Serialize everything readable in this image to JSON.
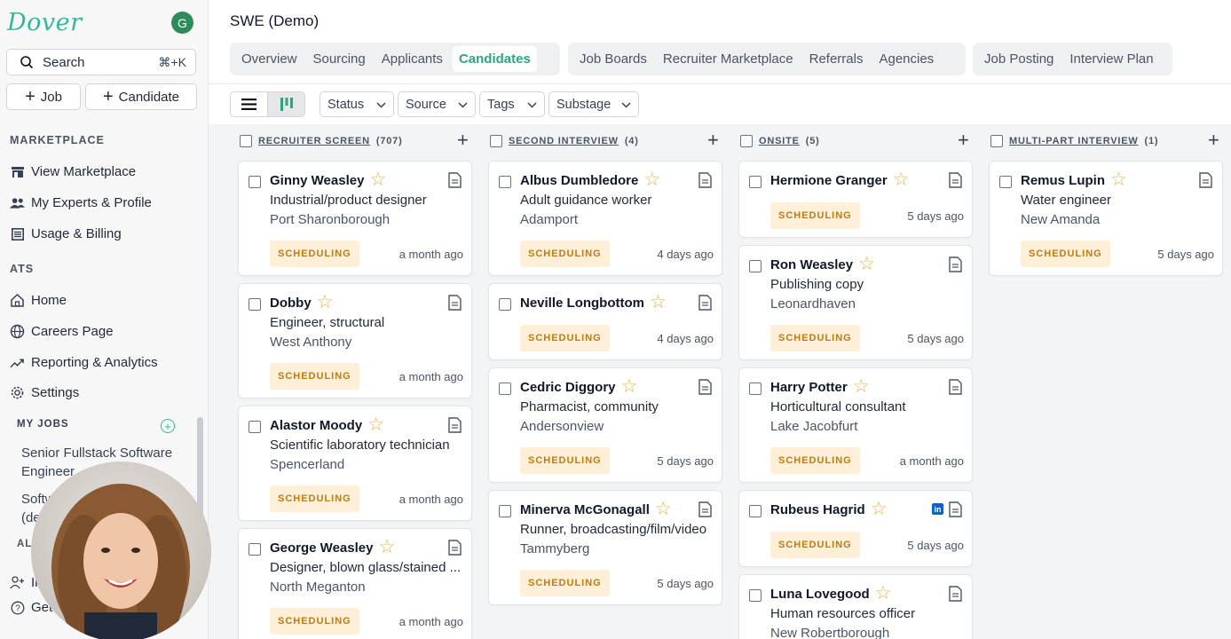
{
  "sidebar": {
    "logo": "Dover",
    "avatar_initial": "G",
    "search": {
      "label": "Search",
      "shortcut": "⌘+K"
    },
    "add_job": "Job",
    "add_candidate": "Candidate",
    "marketplace_label": "MARKETPLACE",
    "marketplace_items": [
      "View Marketplace",
      "My Experts & Profile",
      "Usage & Billing"
    ],
    "ats_label": "ATS",
    "ats_items": [
      "Home",
      "Careers Page",
      "Reporting & Analytics",
      "Settings"
    ],
    "my_jobs_label": "MY JOBS",
    "jobs": [
      "Senior Fullstack Software Engineer",
      "Softw",
      "(de"
    ],
    "partial_section": "AL",
    "bottom_items": [
      "In",
      "Get"
    ]
  },
  "header": {
    "title": "SWE (Demo)",
    "tab_groups": [
      [
        "Overview",
        "Sourcing",
        "Applicants",
        "Candidates"
      ],
      [
        "Job Boards",
        "Recruiter Marketplace",
        "Referrals",
        "Agencies"
      ],
      [
        "Job Posting",
        "Interview Plan"
      ]
    ],
    "active_tab": "Candidates"
  },
  "filters": [
    "Status",
    "Source",
    "Tags",
    "Substage"
  ],
  "columns": [
    {
      "name": "RECRUITER SCREEN",
      "count": "(707)",
      "cards": [
        {
          "name": "Ginny Weasley",
          "title": "Industrial/product designer",
          "location": "Port Sharonborough",
          "status": "SCHEDULING",
          "ago": "a month ago"
        },
        {
          "name": "Dobby",
          "title": "Engineer, structural",
          "location": "West Anthony",
          "status": "SCHEDULING",
          "ago": "a month ago"
        },
        {
          "name": "Alastor Moody",
          "title": "Scientific laboratory technician",
          "location": "Spencerland",
          "status": "SCHEDULING",
          "ago": "a month ago"
        },
        {
          "name": "George Weasley",
          "title": "Designer, blown glass/stained ...",
          "location": "North Meganton",
          "status": "SCHEDULING",
          "ago": "a month ago"
        }
      ]
    },
    {
      "name": "SECOND INTERVIEW",
      "count": "(4)",
      "cards": [
        {
          "name": "Albus Dumbledore",
          "title": "Adult guidance worker",
          "location": "Adamport",
          "status": "SCHEDULING",
          "ago": "4 days ago"
        },
        {
          "name": "Neville Longbottom",
          "title": "",
          "location": "",
          "status": "SCHEDULING",
          "ago": "4 days ago"
        },
        {
          "name": "Cedric Diggory",
          "title": "Pharmacist, community",
          "location": "Andersonview",
          "status": "SCHEDULING",
          "ago": "5 days ago"
        },
        {
          "name": "Minerva McGonagall",
          "title": "Runner, broadcasting/film/video",
          "location": "Tammyberg",
          "status": "SCHEDULING",
          "ago": "5 days ago"
        }
      ]
    },
    {
      "name": "ONSITE",
      "count": "(5)",
      "cards": [
        {
          "name": "Hermione Granger",
          "title": "",
          "location": "",
          "status": "SCHEDULING",
          "ago": "5 days ago"
        },
        {
          "name": "Ron Weasley",
          "title": "Publishing copy",
          "location": "Leonardhaven",
          "status": "SCHEDULING",
          "ago": "5 days ago"
        },
        {
          "name": "Harry Potter",
          "title": "Horticultural consultant",
          "location": "Lake Jacobfurt",
          "status": "SCHEDULING",
          "ago": "a month ago"
        },
        {
          "name": "Rubeus Hagrid",
          "title": "",
          "location": "",
          "status": "SCHEDULING",
          "ago": "5 days ago",
          "linkedin": "in"
        },
        {
          "name": "Luna Lovegood",
          "title": "Human resources officer",
          "location": "New Robertborough",
          "status": "",
          "ago": ""
        }
      ]
    },
    {
      "name": "MULTI-PART INTERVIEW",
      "count": "(1)",
      "cards": [
        {
          "name": "Remus Lupin",
          "title": "Water engineer",
          "location": "New Amanda",
          "status": "SCHEDULING",
          "ago": "5 days ago"
        }
      ]
    }
  ],
  "colors": {
    "accent": "#2fa57f",
    "badge_bg": "#fdefd8",
    "badge_text": "#c07b12",
    "star": "#e8b342",
    "linkedin": "#0a66c2"
  }
}
